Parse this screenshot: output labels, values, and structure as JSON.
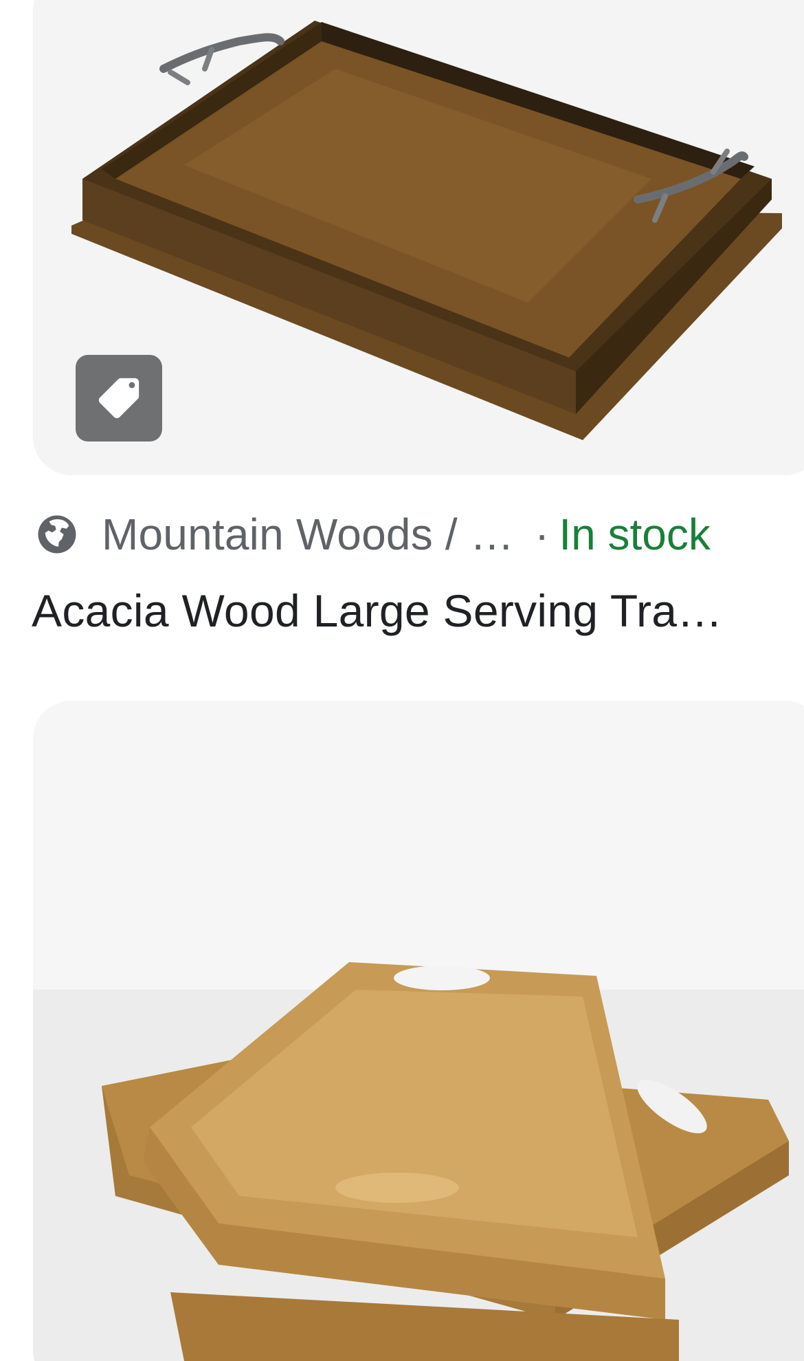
{
  "results": [
    {
      "image_alt_icon": "price-tag-icon",
      "source": {
        "icon": "globe-icon",
        "name": "Mountain Woods / …",
        "separator": "·",
        "availability": "In stock",
        "availability_color": "#188038"
      },
      "title": "Acacia Wood Large Serving Tra…"
    }
  ]
}
